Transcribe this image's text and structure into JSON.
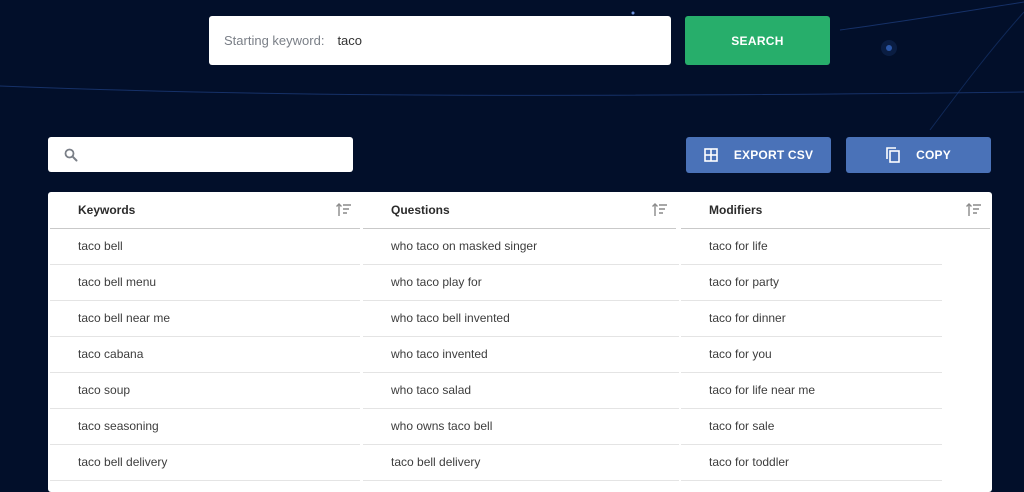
{
  "search": {
    "label": "Starting keyword:",
    "value": "taco",
    "button_label": "SEARCH"
  },
  "filter": {
    "placeholder": "",
    "icon": "search-icon"
  },
  "actions": {
    "export_label": "EXPORT CSV",
    "export_icon": "grid-icon",
    "copy_label": "COPY",
    "copy_icon": "copy-icon"
  },
  "table": {
    "headers": [
      "Keywords",
      "Questions",
      "Modifiers"
    ],
    "rows": [
      [
        "taco bell",
        "who taco on masked singer",
        "taco for life"
      ],
      [
        "taco bell menu",
        "who taco play for",
        "taco for party"
      ],
      [
        "taco bell near me",
        "who taco bell invented",
        "taco for dinner"
      ],
      [
        "taco cabana",
        "who taco invented",
        "taco for you"
      ],
      [
        "taco soup",
        "who taco salad",
        "taco for life near me"
      ],
      [
        "taco seasoning",
        "who owns taco bell",
        "taco for sale"
      ],
      [
        "taco bell delivery",
        "taco bell delivery",
        "taco for toddler"
      ]
    ]
  },
  "colors": {
    "background": "#020f2a",
    "search_button": "#27ae6b",
    "action_button": "#4a72b8"
  }
}
